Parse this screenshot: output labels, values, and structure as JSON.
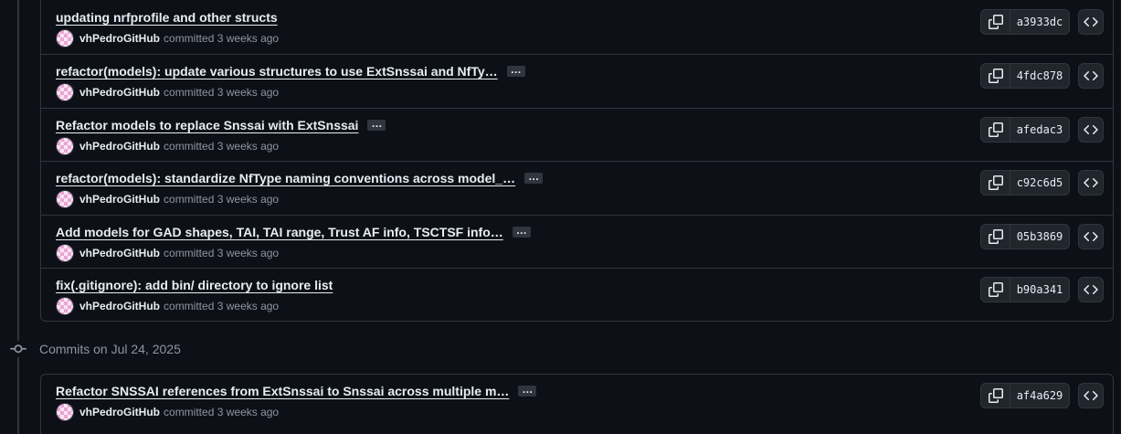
{
  "groups": [
    {
      "commits": [
        {
          "title": "updating nrfprofile and other structs",
          "author": "vhPedroGitHub",
          "action": "committed",
          "time": "3 weeks ago",
          "sha": "a3933dc",
          "has_more": false
        },
        {
          "title": "refactor(models): update various structures to use ExtSnssai and NfTy…",
          "author": "vhPedroGitHub",
          "action": "committed",
          "time": "3 weeks ago",
          "sha": "4fdc878",
          "has_more": true
        },
        {
          "title": "Refactor models to replace Snssai with ExtSnssai",
          "author": "vhPedroGitHub",
          "action": "committed",
          "time": "3 weeks ago",
          "sha": "afedac3",
          "has_more": true
        },
        {
          "title": "refactor(models): standardize NfType naming conventions across model_…",
          "author": "vhPedroGitHub",
          "action": "committed",
          "time": "3 weeks ago",
          "sha": "c92c6d5",
          "has_more": true
        },
        {
          "title": "Add models for GAD shapes, TAI, TAI range, Trust AF info, TSCTSF info…",
          "author": "vhPedroGitHub",
          "action": "committed",
          "time": "3 weeks ago",
          "sha": "05b3869",
          "has_more": true
        },
        {
          "title": "fix(.gitignore): add bin/ directory to ignore list",
          "author": "vhPedroGitHub",
          "action": "committed",
          "time": "3 weeks ago",
          "sha": "b90a341",
          "has_more": false
        }
      ]
    },
    {
      "heading": "Commits on Jul 24, 2025",
      "commits": [
        {
          "title": "Refactor SNSSAI references from ExtSnssai to Snssai across multiple m…",
          "author": "vhPedroGitHub",
          "action": "committed",
          "time": "3 weeks ago",
          "sha": "af4a629",
          "has_more": true
        }
      ]
    }
  ],
  "ellipsis_label": "…",
  "icons": {
    "copy": "copy-icon",
    "code": "code-icon",
    "commit": "git-commit-icon"
  },
  "colors": {
    "background": "#0d1117",
    "border": "#30363d",
    "muted": "#8d96a0",
    "text": "#e6edf3"
  }
}
